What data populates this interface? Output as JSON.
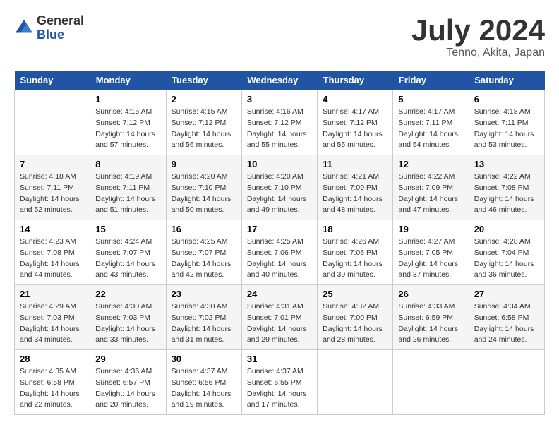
{
  "logo": {
    "general": "General",
    "blue": "Blue"
  },
  "title": "July 2024",
  "subtitle": "Tenno, Akita, Japan",
  "days_of_week": [
    "Sunday",
    "Monday",
    "Tuesday",
    "Wednesday",
    "Thursday",
    "Friday",
    "Saturday"
  ],
  "weeks": [
    [
      {
        "day": "",
        "sunrise": "",
        "sunset": "",
        "daylight": ""
      },
      {
        "day": "1",
        "sunrise": "4:15 AM",
        "sunset": "7:12 PM",
        "daylight": "14 hours and 57 minutes."
      },
      {
        "day": "2",
        "sunrise": "4:15 AM",
        "sunset": "7:12 PM",
        "daylight": "14 hours and 56 minutes."
      },
      {
        "day": "3",
        "sunrise": "4:16 AM",
        "sunset": "7:12 PM",
        "daylight": "14 hours and 55 minutes."
      },
      {
        "day": "4",
        "sunrise": "4:17 AM",
        "sunset": "7:12 PM",
        "daylight": "14 hours and 55 minutes."
      },
      {
        "day": "5",
        "sunrise": "4:17 AM",
        "sunset": "7:11 PM",
        "daylight": "14 hours and 54 minutes."
      },
      {
        "day": "6",
        "sunrise": "4:18 AM",
        "sunset": "7:11 PM",
        "daylight": "14 hours and 53 minutes."
      }
    ],
    [
      {
        "day": "7",
        "sunrise": "4:18 AM",
        "sunset": "7:11 PM",
        "daylight": "14 hours and 52 minutes."
      },
      {
        "day": "8",
        "sunrise": "4:19 AM",
        "sunset": "7:11 PM",
        "daylight": "14 hours and 51 minutes."
      },
      {
        "day": "9",
        "sunrise": "4:20 AM",
        "sunset": "7:10 PM",
        "daylight": "14 hours and 50 minutes."
      },
      {
        "day": "10",
        "sunrise": "4:20 AM",
        "sunset": "7:10 PM",
        "daylight": "14 hours and 49 minutes."
      },
      {
        "day": "11",
        "sunrise": "4:21 AM",
        "sunset": "7:09 PM",
        "daylight": "14 hours and 48 minutes."
      },
      {
        "day": "12",
        "sunrise": "4:22 AM",
        "sunset": "7:09 PM",
        "daylight": "14 hours and 47 minutes."
      },
      {
        "day": "13",
        "sunrise": "4:22 AM",
        "sunset": "7:08 PM",
        "daylight": "14 hours and 46 minutes."
      }
    ],
    [
      {
        "day": "14",
        "sunrise": "4:23 AM",
        "sunset": "7:08 PM",
        "daylight": "14 hours and 44 minutes."
      },
      {
        "day": "15",
        "sunrise": "4:24 AM",
        "sunset": "7:07 PM",
        "daylight": "14 hours and 43 minutes."
      },
      {
        "day": "16",
        "sunrise": "4:25 AM",
        "sunset": "7:07 PM",
        "daylight": "14 hours and 42 minutes."
      },
      {
        "day": "17",
        "sunrise": "4:25 AM",
        "sunset": "7:06 PM",
        "daylight": "14 hours and 40 minutes."
      },
      {
        "day": "18",
        "sunrise": "4:26 AM",
        "sunset": "7:06 PM",
        "daylight": "14 hours and 39 minutes."
      },
      {
        "day": "19",
        "sunrise": "4:27 AM",
        "sunset": "7:05 PM",
        "daylight": "14 hours and 37 minutes."
      },
      {
        "day": "20",
        "sunrise": "4:28 AM",
        "sunset": "7:04 PM",
        "daylight": "14 hours and 36 minutes."
      }
    ],
    [
      {
        "day": "21",
        "sunrise": "4:29 AM",
        "sunset": "7:03 PM",
        "daylight": "14 hours and 34 minutes."
      },
      {
        "day": "22",
        "sunrise": "4:30 AM",
        "sunset": "7:03 PM",
        "daylight": "14 hours and 33 minutes."
      },
      {
        "day": "23",
        "sunrise": "4:30 AM",
        "sunset": "7:02 PM",
        "daylight": "14 hours and 31 minutes."
      },
      {
        "day": "24",
        "sunrise": "4:31 AM",
        "sunset": "7:01 PM",
        "daylight": "14 hours and 29 minutes."
      },
      {
        "day": "25",
        "sunrise": "4:32 AM",
        "sunset": "7:00 PM",
        "daylight": "14 hours and 28 minutes."
      },
      {
        "day": "26",
        "sunrise": "4:33 AM",
        "sunset": "6:59 PM",
        "daylight": "14 hours and 26 minutes."
      },
      {
        "day": "27",
        "sunrise": "4:34 AM",
        "sunset": "6:58 PM",
        "daylight": "14 hours and 24 minutes."
      }
    ],
    [
      {
        "day": "28",
        "sunrise": "4:35 AM",
        "sunset": "6:58 PM",
        "daylight": "14 hours and 22 minutes."
      },
      {
        "day": "29",
        "sunrise": "4:36 AM",
        "sunset": "6:57 PM",
        "daylight": "14 hours and 20 minutes."
      },
      {
        "day": "30",
        "sunrise": "4:37 AM",
        "sunset": "6:56 PM",
        "daylight": "14 hours and 19 minutes."
      },
      {
        "day": "31",
        "sunrise": "4:37 AM",
        "sunset": "6:55 PM",
        "daylight": "14 hours and 17 minutes."
      },
      {
        "day": "",
        "sunrise": "",
        "sunset": "",
        "daylight": ""
      },
      {
        "day": "",
        "sunrise": "",
        "sunset": "",
        "daylight": ""
      },
      {
        "day": "",
        "sunrise": "",
        "sunset": "",
        "daylight": ""
      }
    ]
  ],
  "labels": {
    "sunrise_prefix": "Sunrise: ",
    "sunset_prefix": "Sunset: ",
    "daylight_prefix": "Daylight: "
  }
}
